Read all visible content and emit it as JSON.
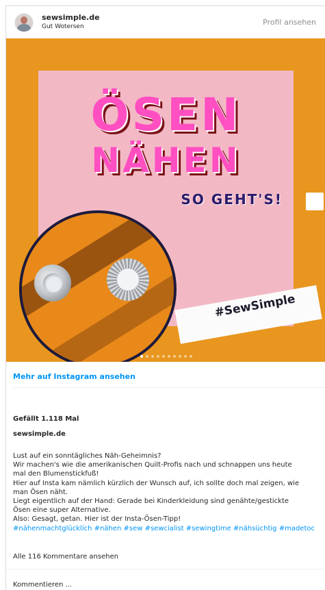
{
  "header": {
    "username": "sewsimple.de",
    "subname": "Gut Wotersen",
    "profile_link": "Profil ansehen"
  },
  "media": {
    "title_line1": "ÖSEN",
    "title_line2": "NÄHEN",
    "subtitle": "SO GEHT'S!",
    "hashtag": "#SewSimple",
    "carousel_total": 10,
    "carousel_active": 1
  },
  "more_link": "Mehr auf Instagram ansehen",
  "likes": "Gefällt 1.118 Mal",
  "owner": "sewsimple.de",
  "caption": {
    "lines": [
      "Lust auf ein sonntägliches Näh-Geheimnis?",
      "Wir machen's wie die amerikanischen Quilt-Profis nach und schnappen uns heute",
      "mal den Blumenstickfuß!",
      "Hier auf Insta kam nämlich kürzlich der Wunsch auf, ich sollte doch mal zeigen, wie",
      "man Ösen näht.",
      "Liegt eigentlich auf der Hand: Gerade bei Kinderkleidung sind genähte/gestickte",
      "Ösen eine super Alternative.",
      "Also: Gesagt, getan. Hier ist der Insta-Ösen-Tipp!"
    ],
    "hashtags": "#nähenmachtglücklich #nähen #sew #sewcialist #sewingtime #nähsüchtig #madetoc"
  },
  "comments_link": "Alle 116 Kommentare ansehen",
  "comment_placeholder": "Kommentieren ...",
  "colors": {
    "link": "#0095f6",
    "media_background": "#e8961f",
    "poster_pink": "#f2b9c5",
    "title_magenta": "#ff4fc1"
  }
}
